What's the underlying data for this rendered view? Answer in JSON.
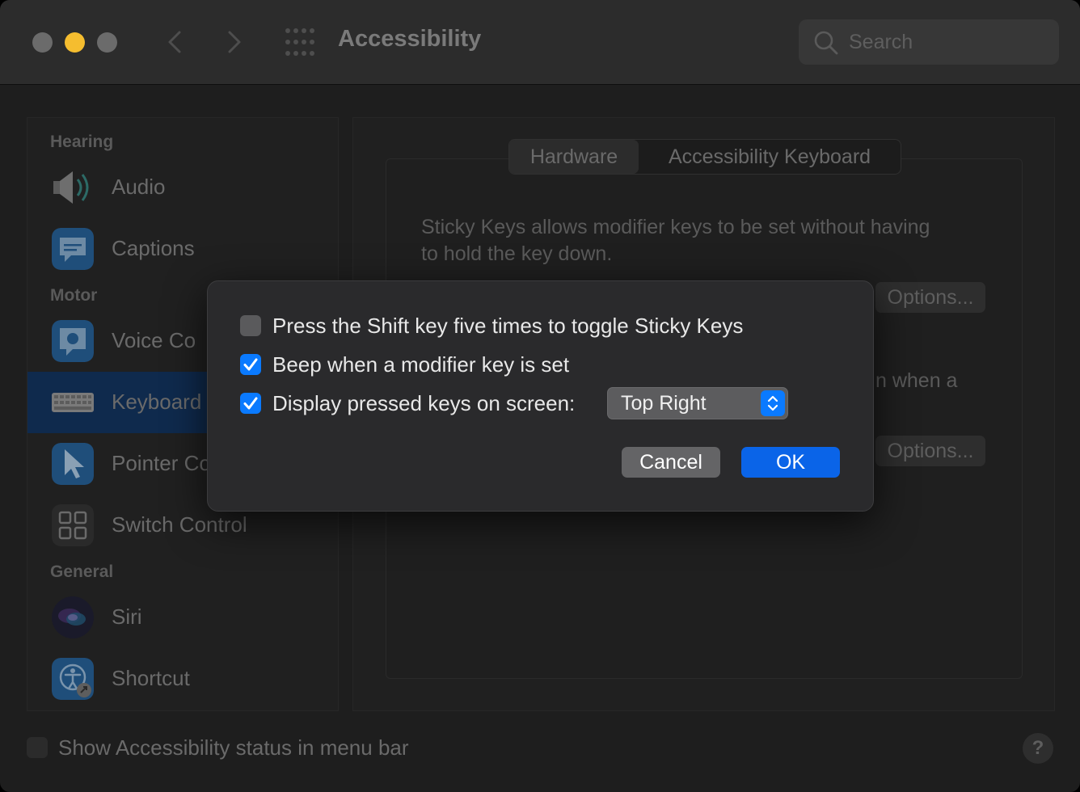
{
  "window": {
    "title": "Accessibility",
    "search_placeholder": "Search",
    "traffic_lights": {
      "close": "#6b6b6b",
      "minimize": "#f5bd2f",
      "zoom": "#6b6b6b"
    }
  },
  "sidebar": {
    "sections": {
      "hearing": "Hearing",
      "motor": "Motor",
      "general": "General"
    },
    "items": [
      {
        "label": "Audio",
        "icon": "speaker-icon"
      },
      {
        "label": "Captions",
        "icon": "captions-icon"
      },
      {
        "label": "Voice Co",
        "icon": "voice-control-icon"
      },
      {
        "label": "Keyboard",
        "icon": "keyboard-icon",
        "selected": true
      },
      {
        "label": "Pointer Co",
        "icon": "pointer-icon"
      },
      {
        "label": "Switch Control",
        "icon": "switch-control-icon"
      },
      {
        "label": "Siri",
        "icon": "siri-icon"
      },
      {
        "label": "Shortcut",
        "icon": "shortcut-icon"
      }
    ]
  },
  "panel": {
    "tabs": [
      "Hardware",
      "Accessibility Keyboard"
    ],
    "active_tab": "Hardware",
    "sticky_desc_line1": "Sticky Keys allows modifier keys to be set without having",
    "sticky_desc_line2": "to hold the key down.",
    "slow_desc_fragment": "n when a",
    "options_label": "Options..."
  },
  "sheet": {
    "shift_toggle_label": "Press the Shift key five times to toggle Sticky Keys",
    "shift_toggle_checked": false,
    "beep_label": "Beep when a modifier key is set",
    "beep_checked": true,
    "display_label": "Display pressed keys on screen:",
    "display_checked": true,
    "display_position": "Top Right",
    "cancel_label": "Cancel",
    "ok_label": "OK"
  },
  "footer": {
    "status_label": "Show Accessibility status in menu bar",
    "status_checked": false,
    "help_label": "?"
  },
  "colors": {
    "accent": "#0a7aff",
    "selected_row": "#0f2a4d"
  }
}
